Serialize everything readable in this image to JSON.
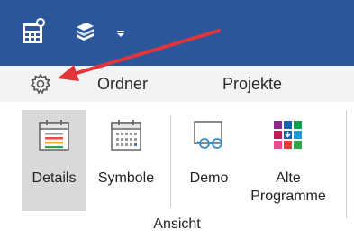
{
  "tabs": {
    "ordner": "Ordner",
    "projekte": "Projekte"
  },
  "ribbon": {
    "buttons": {
      "details": "Details",
      "symbole": "Symbole",
      "demo": "Demo",
      "alte_line1": "Alte",
      "alte_line2": "Programme"
    },
    "group_label": "Ansicht"
  },
  "colors": {
    "titlebar": "#2b579a",
    "arrow": "#e0353a",
    "selected_button": "#d9d9d9"
  },
  "icons": {
    "gear": "gear-icon",
    "calc": "calculator-icon",
    "book": "book-stack-icon",
    "details": "calendar-details-icon",
    "symbole": "calendar-grid-icon",
    "demo": "glasses-screen-icon",
    "alte": "colored-grid-icon"
  }
}
